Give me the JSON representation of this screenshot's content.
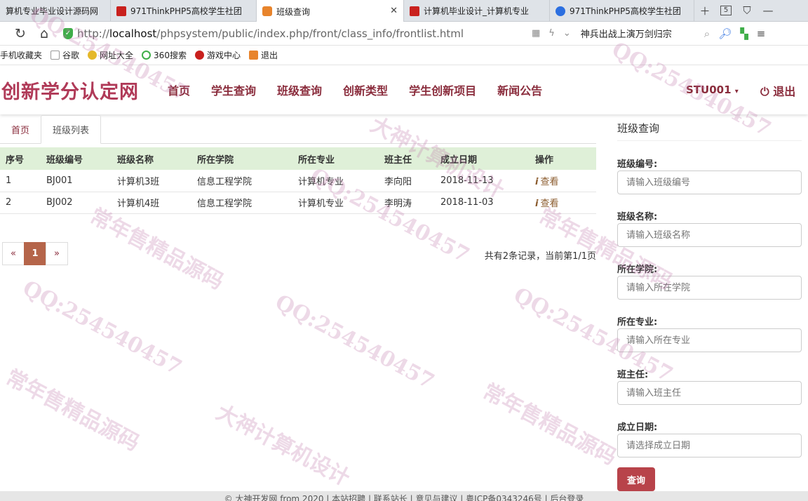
{
  "browser": {
    "tabs": [
      {
        "label": "算机专业毕业设计源码网",
        "icon": "page-icon"
      },
      {
        "label": "971ThinkPHP5高校学生社团",
        "icon": "red-flag-icon"
      },
      {
        "label": "班级查询",
        "icon": "orange-app-icon"
      },
      {
        "label": "计算机毕业设计_计算机专业",
        "icon": "red-flag-icon"
      },
      {
        "label": "971ThinkPHP5高校学生社团",
        "icon": "paw-icon"
      }
    ],
    "tab_count": "5",
    "url_prefix": "http://",
    "url_host": "localhost",
    "url_path": "/phpsystem/public/index.php/front/class_info/frontlist.html",
    "search_text": "神兵出战上演万剑归宗",
    "bookmarks": [
      "手机收藏夹",
      "谷歌",
      "网址大全",
      "360搜索",
      "游戏中心",
      "退出"
    ]
  },
  "site": {
    "brand": "创新学分认定网",
    "nav": [
      "首页",
      "学生查询",
      "班级查询",
      "创新类型",
      "学生创新项目",
      "新闻公告"
    ],
    "user": "STU001",
    "logout": "退出"
  },
  "crumbs": {
    "home": "首页",
    "current": "班级列表"
  },
  "table": {
    "headers": [
      "序号",
      "班级编号",
      "班级名称",
      "所在学院",
      "所在专业",
      "班主任",
      "成立日期",
      "操作"
    ],
    "rows": [
      [
        "1",
        "BJ001",
        "计算机3班",
        "信息工程学院",
        "计算机专业",
        "李向阳",
        "2018-11-13",
        "查看"
      ],
      [
        "2",
        "BJ002",
        "计算机4班",
        "信息工程学院",
        "计算机专业",
        "李明涛",
        "2018-11-03",
        "查看"
      ]
    ]
  },
  "pager": {
    "prev": "«",
    "current": "1",
    "next": "»",
    "info": "共有2条记录，当前第1/1页"
  },
  "panel": {
    "title": "班级查询",
    "fields": [
      {
        "label": "班级编号:",
        "placeholder": "请输入班级编号"
      },
      {
        "label": "班级名称:",
        "placeholder": "请输入班级名称"
      },
      {
        "label": "所在学院:",
        "placeholder": "请输入所在学院"
      },
      {
        "label": "所在专业:",
        "placeholder": "请输入所在专业"
      },
      {
        "label": "班主任:",
        "placeholder": "请输入班主任"
      },
      {
        "label": "成立日期:",
        "placeholder": "请选择成立日期"
      }
    ],
    "button": "查询"
  },
  "footer": "© 大神开发网 from 2020 | 本站招聘 | 联系站长 | 意见与建议 | 粤ICP备0343246号 | 后台登录",
  "watermarks": [
    "QQ:254540457",
    "大神计算机设计",
    "常年售精品源码"
  ],
  "colors": {
    "accent": "#8a2c3c",
    "brand": "#b03a58",
    "table_header": "#dff0d8",
    "button": "#b8434a",
    "pager_active": "#b5654a"
  }
}
